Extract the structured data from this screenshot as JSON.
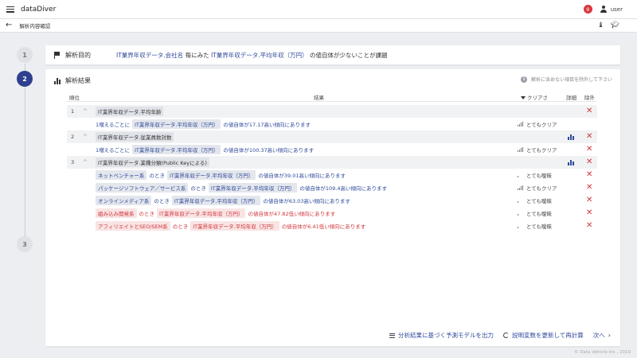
{
  "app": {
    "title": "dataDiver",
    "notifications": "9",
    "user": "user"
  },
  "subheader": {
    "title": "解析内容確認"
  },
  "steps": [
    "1",
    "2",
    "3"
  ],
  "purpose": {
    "label": "解析目的",
    "var1": "IT業界年収データ.会社名",
    "mid": "毎にみた",
    "var2": "IT業界年収データ.平均年収（万円）",
    "tail": "の値自体が少ないことが課題"
  },
  "results": {
    "label": "解析結果",
    "note": "解析に含めない項目を除外して下さい",
    "headers": {
      "rank": "順位",
      "result": "結果",
      "clarity": "クリアさ",
      "detail": "詳細",
      "exclude": "除外"
    },
    "groups": [
      {
        "rank": "1",
        "variable": "IT業界年収データ.平均年齢"
      },
      {
        "rank": "2",
        "variable": "IT業界年収データ.従業員数対数"
      },
      {
        "rank": "3",
        "variable": "IT業界年収データ.業種分類(Public Keyによる)"
      }
    ],
    "rows": [
      {
        "prefix": "1増えるごとに",
        "target": "IT業界年収データ.平均年収（万円）",
        "suffix": "の値自体が17.17高い傾向にあります",
        "clarity": "とてもクリア"
      },
      {
        "prefix": "1増えるごとに",
        "target": "IT業界年収データ.平均年収（万円）",
        "suffix": "の値自体が100.37高い傾向にあります",
        "clarity": "とてもクリア"
      },
      {
        "category": "ネットベンチャー系",
        "when": "のとき",
        "target": "IT業界年収データ.平均年収（万円）",
        "suffix": "の値自体が39.01高い傾向にあります",
        "clarity": "とても曖昧"
      },
      {
        "category": "パッケージソフトウェア／サービス系",
        "when": "のとき",
        "target": "IT業界年収データ.平均年収（万円）",
        "suffix": "の値自体が109.4高い傾向にあります",
        "clarity": "とてもクリア"
      },
      {
        "category": "オンラインメディア系",
        "when": "のとき",
        "target": "IT業界年収データ.平均年収（万円）",
        "suffix": "の値自体が63.03高い傾向にあります",
        "clarity": "とても曖昧"
      },
      {
        "category": "組み込み開発系",
        "when": "のとき",
        "target": "IT業界年収データ.平均年収（万円）",
        "suffix": "の値自体が47.82低い傾向にあります",
        "clarity": "とても曖昧"
      },
      {
        "category": "アフィリエイトとSEO/SEM系",
        "when": "のとき",
        "target": "IT業界年収データ.平均年収（万円）",
        "suffix": "の値自体が6.41低い傾向にあります",
        "clarity": "とても曖昧"
      }
    ]
  },
  "actions": {
    "export": "分析結果に基づく予測モデルを出力",
    "recalc": "説明変数を更新して再計算",
    "next": "次へ"
  },
  "copyright": "© Data Vehicle Inc., 2019",
  "colors": {
    "accent": "#2e4a9a",
    "negative": "#d0353b",
    "step_active": "#2e3f8f"
  }
}
